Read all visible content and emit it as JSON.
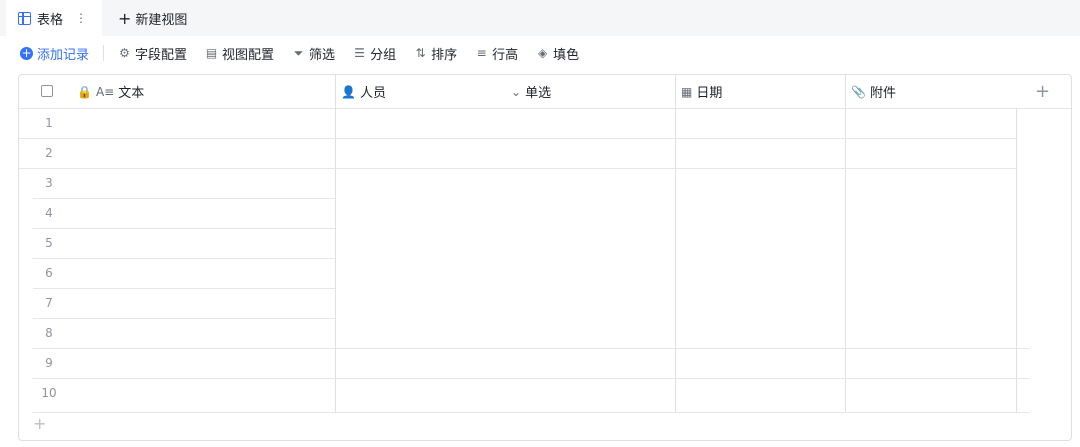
{
  "tabs": {
    "active_label": "表格",
    "more_icon": "more-vertical-icon",
    "new_view_label": "新建视图"
  },
  "toolbar": {
    "add_record": "添加记录",
    "field_config": "字段配置",
    "view_config": "视图配置",
    "filter": "筛选",
    "group": "分组",
    "sort": "排序",
    "row_height": "行高",
    "fill_color": "填色"
  },
  "columns": [
    {
      "label": "文本",
      "icon": "text-icon"
    },
    {
      "label": "人员",
      "icon": "person-icon"
    },
    {
      "label": "单选",
      "icon": "single-select-icon"
    },
    {
      "label": "日期",
      "icon": "calendar-icon"
    },
    {
      "label": "附件",
      "icon": "attachment-icon"
    }
  ],
  "rows": [
    "1",
    "2",
    "3",
    "4",
    "5",
    "6",
    "7",
    "8",
    "9",
    "10"
  ],
  "colors": {
    "accent": "#3370ff",
    "border": "#dee0e3",
    "muted": "#8f959e"
  }
}
